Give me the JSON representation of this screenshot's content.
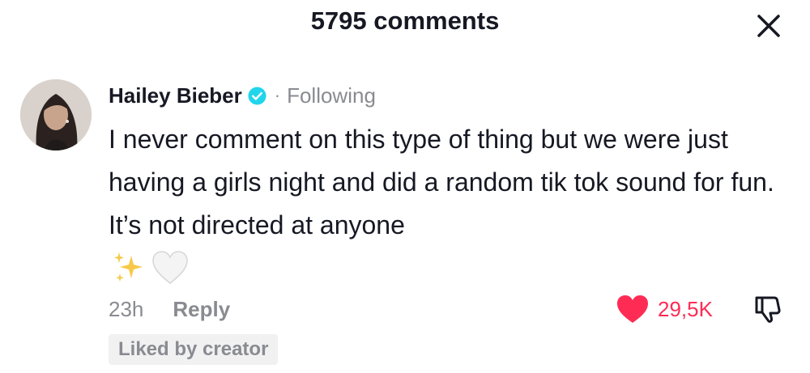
{
  "header": {
    "comment_count_label": "5795 comments",
    "close_icon": "close-icon"
  },
  "comment": {
    "avatar_icon": "avatar",
    "username": "Hailey Bieber",
    "verified_icon": "verified-badge-icon",
    "separator": "·",
    "follow_status": "Following",
    "text": "I never comment on this type of thing but we were just having a girls night and did a random tik tok sound for fun. It’s not directed at anyone",
    "emojis": [
      "sparkles-icon",
      "white-heart-icon"
    ],
    "time": "23h",
    "reply_label": "Reply",
    "like_count": "29,5K",
    "liked": true,
    "liked_by_creator_label": "Liked by creator"
  },
  "colors": {
    "accent": "#fe2c55",
    "verified": "#20d5ec",
    "muted_text": "#8a8b91",
    "primary_text": "#161823"
  }
}
